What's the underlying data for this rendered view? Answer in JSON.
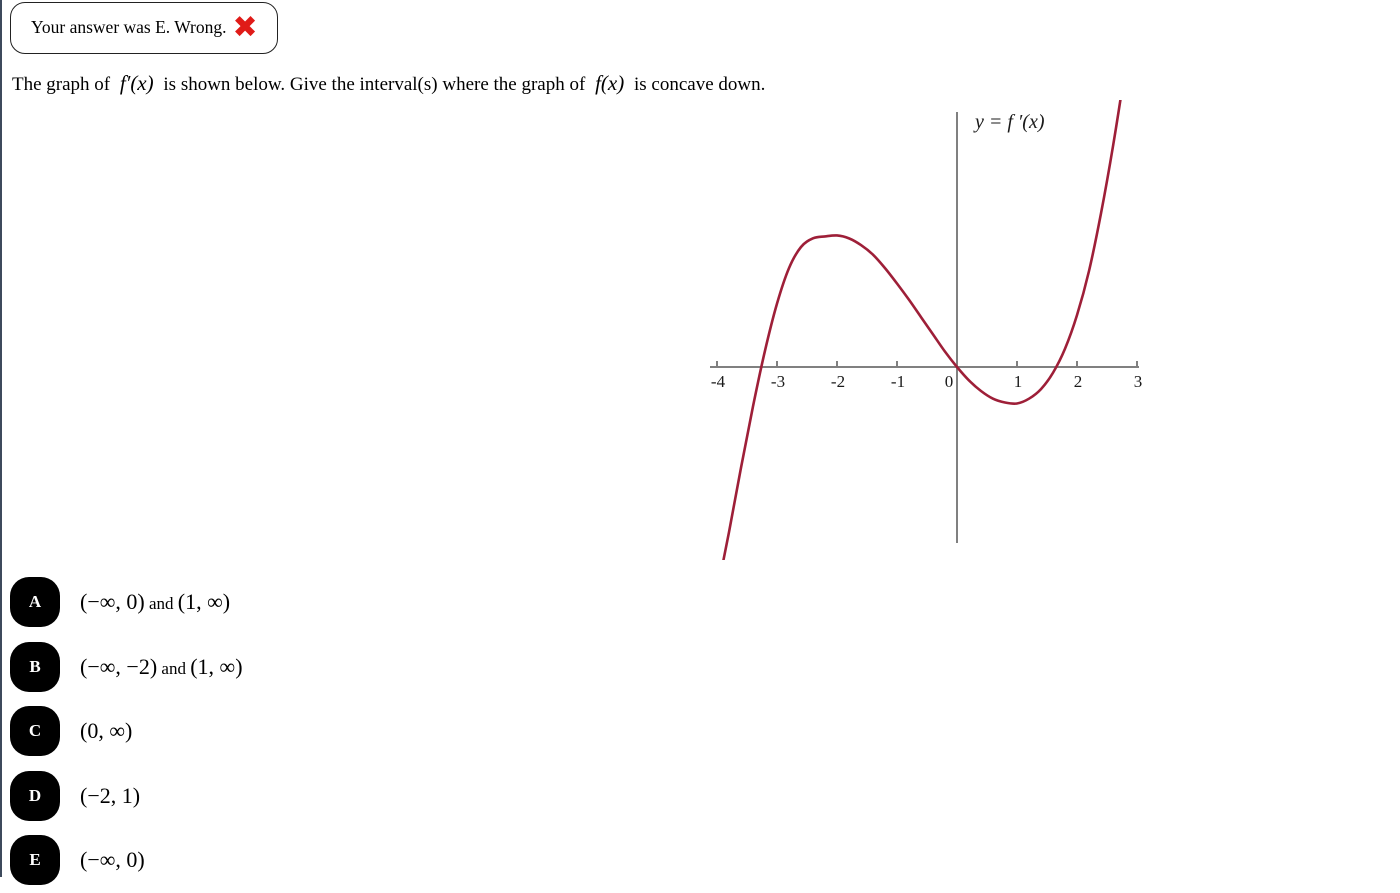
{
  "feedback": {
    "message": "Your answer was E. Wrong.",
    "mark_icon": "red-x-icon",
    "mark_glyph": "✖",
    "mark_color": "#e01b18"
  },
  "prompt": {
    "part1": "The graph of",
    "math1": "f′(x)",
    "part2": "is shown below. Give the interval(s) where the graph of",
    "math2": "f(x)",
    "part3": "is concave down."
  },
  "graph": {
    "curve_label": "y = f ′(x)",
    "curve_color": "#9e1f38",
    "axis_color": "#808080",
    "x_tick_labels": [
      "-4",
      "-3",
      "-2",
      "-1",
      "0",
      "1",
      "2",
      "3"
    ],
    "x_axis_min": -4,
    "x_axis_max": 3,
    "origin_label": "0"
  },
  "chart_data": {
    "type": "line",
    "title": "y = f '(x)",
    "xlabel": "",
    "ylabel": "",
    "xlim": [
      -4.3,
      3.1
    ],
    "ylim": [
      -1.2,
      3.4
    ],
    "grid": false,
    "legend": "none",
    "x_ticks": [
      -4,
      -3,
      -2,
      -1,
      0,
      1,
      2,
      3
    ],
    "x_tick_labels": [
      "-4",
      "-3",
      "-2",
      "-1",
      "0",
      "1",
      "2",
      "3"
    ],
    "y_ticks": [],
    "series": [
      {
        "name": "f'(x)",
        "color": "#9e1f38",
        "description": "Cubic with local maximum near x = -2, local minimum near x = 1, zeros near x = -3.4, x = 0 and x = 1.85",
        "x": [
          -4.05,
          -3.8,
          -3.6,
          -3.4,
          -3.2,
          -3.0,
          -2.8,
          -2.6,
          -2.4,
          -2.2,
          -2.0,
          -1.8,
          -1.6,
          -1.4,
          -1.2,
          -1.0,
          -0.8,
          -0.6,
          -0.4,
          -0.2,
          0.0,
          0.2,
          0.4,
          0.6,
          0.8,
          1.0,
          1.2,
          1.4,
          1.6,
          1.8,
          2.0,
          2.2,
          2.4,
          2.6,
          2.8,
          3.0
        ],
        "y": [
          -2.5,
          -1.72,
          -1.05,
          -0.41,
          0.17,
          0.66,
          1.03,
          1.25,
          1.34,
          1.36,
          1.37,
          1.34,
          1.27,
          1.17,
          1.03,
          0.87,
          0.7,
          0.52,
          0.34,
          0.16,
          0.0,
          -0.14,
          -0.25,
          -0.33,
          -0.37,
          -0.38,
          -0.33,
          -0.23,
          -0.06,
          0.19,
          0.54,
          1.0,
          1.6,
          2.3,
          3.1,
          4.0
        ]
      }
    ],
    "annotations": [
      {
        "text": "y = f '(x)",
        "x": 0.15,
        "y": 3.15
      }
    ]
  },
  "options": [
    {
      "letter": "A",
      "text_main": "(−∞, 0)",
      "text_conj": " and ",
      "text_second": "(1, ∞)"
    },
    {
      "letter": "B",
      "text_main": "(−∞, −2)",
      "text_conj": " and ",
      "text_second": "(1, ∞)"
    },
    {
      "letter": "C",
      "text_main": "(0, ∞)",
      "text_conj": "",
      "text_second": ""
    },
    {
      "letter": "D",
      "text_main": "(−2, 1)",
      "text_conj": "",
      "text_second": ""
    },
    {
      "letter": "E",
      "text_main": "(−∞, 0)",
      "text_conj": "",
      "text_second": ""
    }
  ]
}
